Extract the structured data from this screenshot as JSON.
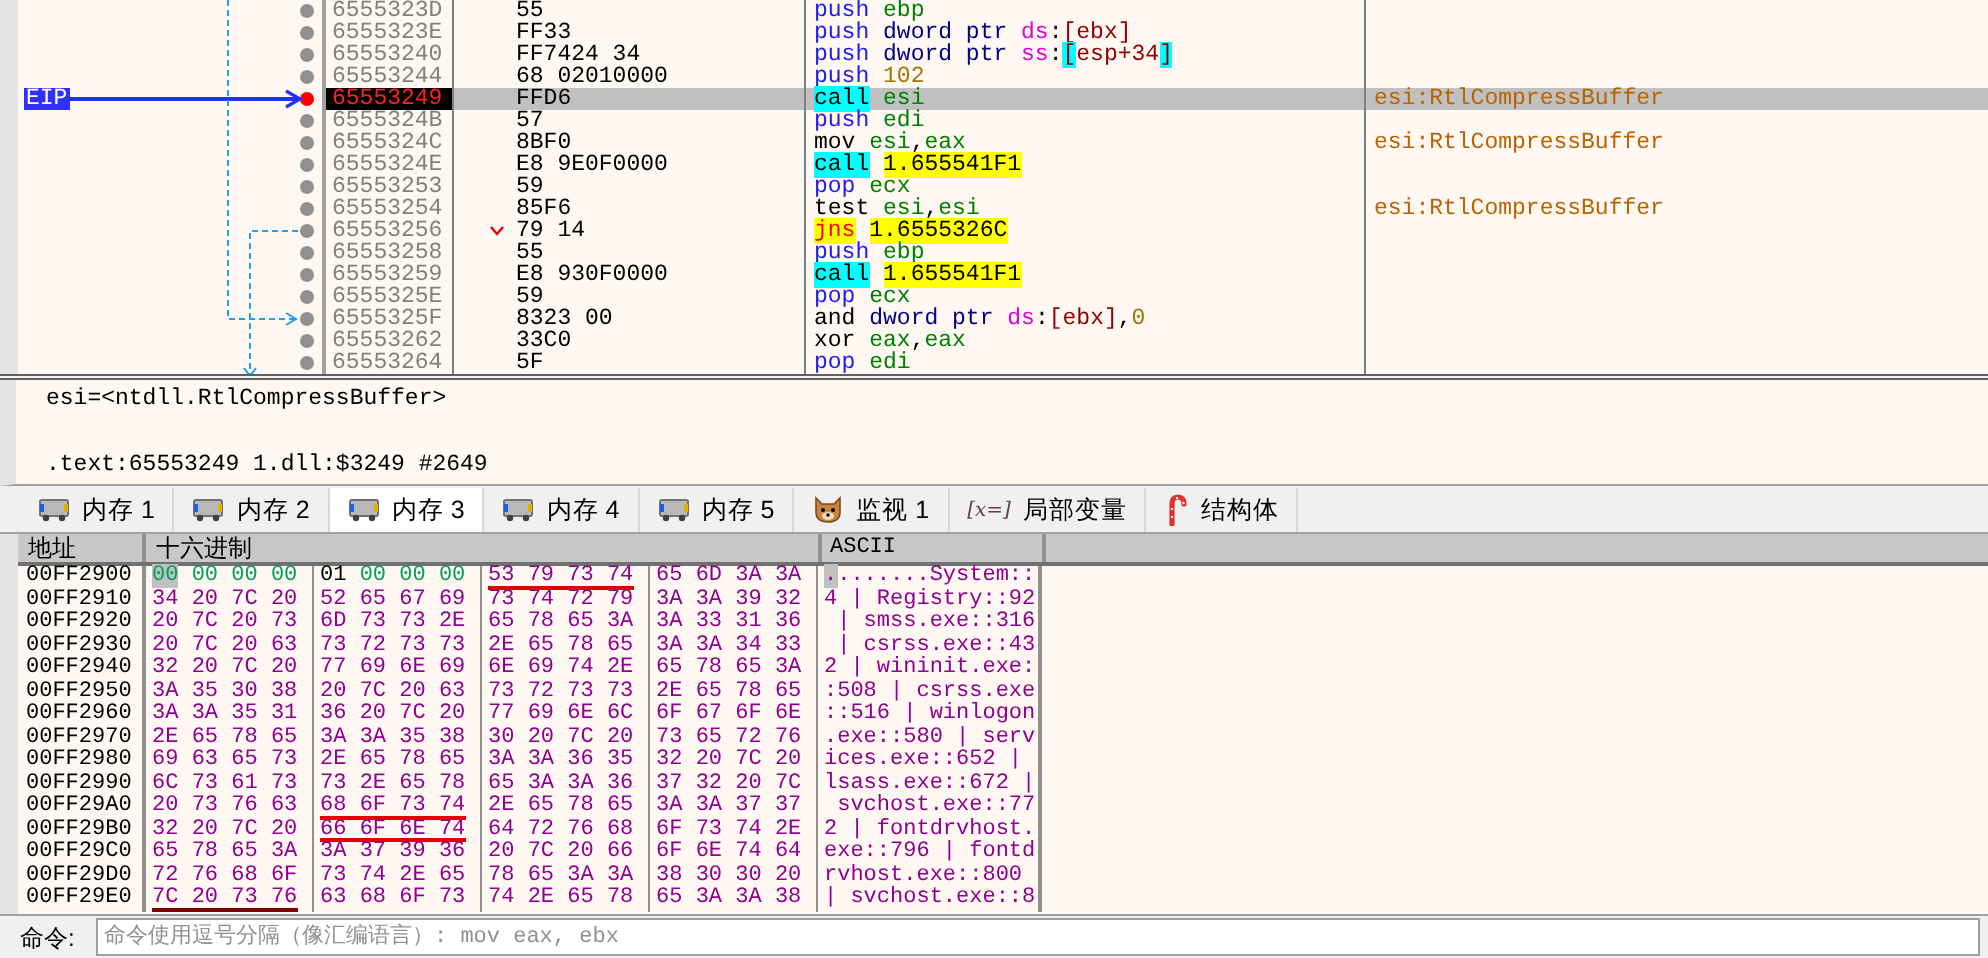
{
  "disassembly": {
    "eip_label": "EIP",
    "rows": [
      {
        "address": "6555323D",
        "bytes": "55",
        "current": false,
        "branch": false,
        "instruction": [
          {
            "text": "push",
            "kind": "stack"
          },
          {
            "text": " ebp",
            "kind": "reg"
          }
        ]
      },
      {
        "address": "6555323E",
        "bytes": "FF33",
        "current": false,
        "branch": false,
        "instruction": [
          {
            "text": "push",
            "kind": "stack"
          },
          {
            "text": " dword ptr ",
            "kind": "size"
          },
          {
            "text": "ds",
            "kind": "seg"
          },
          {
            "text": ":",
            "kind": "plain"
          },
          {
            "text": "[ebx]",
            "kind": "mem"
          }
        ]
      },
      {
        "address": "65553240",
        "bytes": "FF7424 34",
        "current": false,
        "branch": false,
        "instruction": [
          {
            "text": "push",
            "kind": "stack"
          },
          {
            "text": " dword ptr ",
            "kind": "size"
          },
          {
            "text": "ss",
            "kind": "seg"
          },
          {
            "text": ":",
            "kind": "plain"
          },
          {
            "text": "[",
            "kind": "hl"
          },
          {
            "text": "esp+34",
            "kind": "mem"
          },
          {
            "text": "]",
            "kind": "hl"
          }
        ]
      },
      {
        "address": "65553244",
        "bytes": "68 02010000",
        "current": false,
        "branch": false,
        "instruction": [
          {
            "text": "push",
            "kind": "stack"
          },
          {
            "text": " 102",
            "kind": "num"
          }
        ]
      },
      {
        "address": "65553249",
        "bytes": "FFD6",
        "current": true,
        "branch": false,
        "instruction": [
          {
            "text": "call",
            "kind": "call"
          },
          {
            "text": " esi",
            "kind": "reg"
          }
        ],
        "comment": "esi:RtlCompressBuffer"
      },
      {
        "address": "6555324B",
        "bytes": "57",
        "current": false,
        "branch": false,
        "instruction": [
          {
            "text": "push",
            "kind": "stack"
          },
          {
            "text": " edi",
            "kind": "reg"
          }
        ]
      },
      {
        "address": "6555324C",
        "bytes": "8BF0",
        "current": false,
        "branch": false,
        "instruction": [
          {
            "text": "mov",
            "kind": "plain"
          },
          {
            "text": " esi",
            "kind": "reg"
          },
          {
            "text": ",",
            "kind": "plain"
          },
          {
            "text": "eax",
            "kind": "reg"
          }
        ],
        "comment": "esi:RtlCompressBuffer"
      },
      {
        "address": "6555324E",
        "bytes": "E8 9E0F0000",
        "current": false,
        "branch": false,
        "instruction": [
          {
            "text": "call",
            "kind": "call"
          },
          {
            "text": " 1.655541F1",
            "kind": "addr"
          }
        ]
      },
      {
        "address": "65553253",
        "bytes": "59",
        "current": false,
        "branch": false,
        "instruction": [
          {
            "text": "pop",
            "kind": "stack"
          },
          {
            "text": " ecx",
            "kind": "reg"
          }
        ]
      },
      {
        "address": "65553254",
        "bytes": "85F6",
        "current": false,
        "branch": false,
        "instruction": [
          {
            "text": "test",
            "kind": "plain"
          },
          {
            "text": " esi",
            "kind": "reg"
          },
          {
            "text": ",",
            "kind": "plain"
          },
          {
            "text": "esi",
            "kind": "reg"
          }
        ],
        "comment": "esi:RtlCompressBuffer"
      },
      {
        "address": "65553256",
        "bytes": "79 14",
        "current": false,
        "branch": true,
        "instruction": [
          {
            "text": "jns",
            "kind": "jump"
          },
          {
            "text": " 1.6555326C",
            "kind": "addr"
          }
        ]
      },
      {
        "address": "65553258",
        "bytes": "55",
        "current": false,
        "branch": false,
        "instruction": [
          {
            "text": "push",
            "kind": "stack"
          },
          {
            "text": " ebp",
            "kind": "reg"
          }
        ]
      },
      {
        "address": "65553259",
        "bytes": "E8 930F0000",
        "current": false,
        "branch": false,
        "instruction": [
          {
            "text": "call",
            "kind": "call"
          },
          {
            "text": " 1.655541F1",
            "kind": "addr"
          }
        ]
      },
      {
        "address": "6555325E",
        "bytes": "59",
        "current": false,
        "branch": false,
        "instruction": [
          {
            "text": "pop",
            "kind": "stack"
          },
          {
            "text": " ecx",
            "kind": "reg"
          }
        ]
      },
      {
        "address": "6555325F",
        "bytes": "8323 00",
        "current": false,
        "branch": false,
        "instruction": [
          {
            "text": "and",
            "kind": "plain"
          },
          {
            "text": " dword ptr ",
            "kind": "size"
          },
          {
            "text": "ds",
            "kind": "seg"
          },
          {
            "text": ":",
            "kind": "plain"
          },
          {
            "text": "[ebx]",
            "kind": "mem"
          },
          {
            "text": ",",
            "kind": "plain"
          },
          {
            "text": "0",
            "kind": "num"
          }
        ]
      },
      {
        "address": "65553262",
        "bytes": "33C0",
        "current": false,
        "branch": false,
        "instruction": [
          {
            "text": "xor",
            "kind": "plain"
          },
          {
            "text": " eax",
            "kind": "reg"
          },
          {
            "text": ",",
            "kind": "plain"
          },
          {
            "text": "eax",
            "kind": "reg"
          }
        ]
      },
      {
        "address": "65553264",
        "bytes": "5F",
        "current": false,
        "branch": false,
        "instruction": [
          {
            "text": "pop",
            "kind": "stack"
          },
          {
            "text": " edi",
            "kind": "reg"
          }
        ]
      }
    ]
  },
  "info": [
    "esi=<ntdll.RtlCompressBuffer>",
    ".text:65553249 1.dll:$3249 #2649"
  ],
  "tabs": [
    {
      "label": "内存 1",
      "kind": "memory",
      "selected": false
    },
    {
      "label": "内存 2",
      "kind": "memory",
      "selected": false
    },
    {
      "label": "内存 3",
      "kind": "memory",
      "selected": true
    },
    {
      "label": "内存 4",
      "kind": "memory",
      "selected": false
    },
    {
      "label": "内存 5",
      "kind": "memory",
      "selected": false
    },
    {
      "label": "监视 1",
      "kind": "watch",
      "selected": false
    },
    {
      "label": "局部变量",
      "kind": "locals",
      "icon_text": "[x=]",
      "selected": false
    },
    {
      "label": "结构体",
      "kind": "struct",
      "selected": false
    }
  ],
  "dump": {
    "columns": [
      "地址",
      "十六进制",
      "ASCII"
    ],
    "rows": [
      {
        "address": "00FF2900",
        "selected": true,
        "groups": [
          {
            "bytes": "00 00 00 00",
            "underlined": false
          },
          {
            "bytes": "01 00 00 00",
            "underlined": false
          },
          {
            "bytes": "53 79 73 74",
            "underlined": true,
            "color": "#e00000"
          },
          {
            "bytes": "65 6D 3A 3A",
            "underlined": false
          }
        ],
        "ascii": "........System::"
      },
      {
        "address": "00FF2910",
        "selected": false,
        "groups": [
          {
            "bytes": "34 20 7C 20",
            "underlined": false
          },
          {
            "bytes": "52 65 67 69",
            "underlined": false
          },
          {
            "bytes": "73 74 72 79",
            "underlined": false
          },
          {
            "bytes": "3A 3A 39 32",
            "underlined": false
          }
        ],
        "ascii": "4 | Registry::92"
      },
      {
        "address": "00FF2920",
        "selected": false,
        "groups": [
          {
            "bytes": "20 7C 20 73",
            "underlined": false
          },
          {
            "bytes": "6D 73 73 2E",
            "underlined": false
          },
          {
            "bytes": "65 78 65 3A",
            "underlined": false
          },
          {
            "bytes": "3A 33 31 36",
            "underlined": false
          }
        ],
        "ascii": " | smss.exe::316"
      },
      {
        "address": "00FF2930",
        "selected": false,
        "groups": [
          {
            "bytes": "20 7C 20 63",
            "underlined": false
          },
          {
            "bytes": "73 72 73 73",
            "underlined": false
          },
          {
            "bytes": "2E 65 78 65",
            "underlined": false
          },
          {
            "bytes": "3A 3A 34 33",
            "underlined": false
          }
        ],
        "ascii": " | csrss.exe::43"
      },
      {
        "address": "00FF2940",
        "selected": false,
        "groups": [
          {
            "bytes": "32 20 7C 20",
            "underlined": false
          },
          {
            "bytes": "77 69 6E 69",
            "underlined": false
          },
          {
            "bytes": "6E 69 74 2E",
            "underlined": false
          },
          {
            "bytes": "65 78 65 3A",
            "underlined": false
          }
        ],
        "ascii": "2 | wininit.exe:"
      },
      {
        "address": "00FF2950",
        "selected": false,
        "groups": [
          {
            "bytes": "3A 35 30 38",
            "underlined": false
          },
          {
            "bytes": "20 7C 20 63",
            "underlined": false
          },
          {
            "bytes": "73 72 73 73",
            "underlined": false
          },
          {
            "bytes": "2E 65 78 65",
            "underlined": false
          }
        ],
        "ascii": ":508 | csrss.exe"
      },
      {
        "address": "00FF2960",
        "selected": false,
        "groups": [
          {
            "bytes": "3A 3A 35 31",
            "underlined": false
          },
          {
            "bytes": "36 20 7C 20",
            "underlined": false
          },
          {
            "bytes": "77 69 6E 6C",
            "underlined": false
          },
          {
            "bytes": "6F 67 6F 6E",
            "underlined": false
          }
        ],
        "ascii": "::516 | winlogon"
      },
      {
        "address": "00FF2970",
        "selected": false,
        "groups": [
          {
            "bytes": "2E 65 78 65",
            "underlined": false
          },
          {
            "bytes": "3A 3A 35 38",
            "underlined": false
          },
          {
            "bytes": "30 20 7C 20",
            "underlined": false
          },
          {
            "bytes": "73 65 72 76",
            "underlined": false
          }
        ],
        "ascii": ".exe::580 | serv"
      },
      {
        "address": "00FF2980",
        "selected": false,
        "groups": [
          {
            "bytes": "69 63 65 73",
            "underlined": false
          },
          {
            "bytes": "2E 65 78 65",
            "underlined": false
          },
          {
            "bytes": "3A 3A 36 35",
            "underlined": false
          },
          {
            "bytes": "32 20 7C 20",
            "underlined": false
          }
        ],
        "ascii": "ices.exe::652 | "
      },
      {
        "address": "00FF2990",
        "selected": false,
        "groups": [
          {
            "bytes": "6C 73 61 73",
            "underlined": false
          },
          {
            "bytes": "73 2E 65 78",
            "underlined": false
          },
          {
            "bytes": "65 3A 3A 36",
            "underlined": false
          },
          {
            "bytes": "37 32 20 7C",
            "underlined": false
          }
        ],
        "ascii": "lsass.exe::672 |"
      },
      {
        "address": "00FF29A0",
        "selected": false,
        "groups": [
          {
            "bytes": "20 73 76 63",
            "underlined": false
          },
          {
            "bytes": "68 6F 73 74",
            "underlined": true,
            "color": "#e00000"
          },
          {
            "bytes": "2E 65 78 65",
            "underlined": false
          },
          {
            "bytes": "3A 3A 37 37",
            "underlined": false
          }
        ],
        "ascii": " svchost.exe::77"
      },
      {
        "address": "00FF29B0",
        "selected": false,
        "groups": [
          {
            "bytes": "32 20 7C 20",
            "underlined": false
          },
          {
            "bytes": "66 6F 6E 74",
            "underlined": true,
            "color": "#e00000"
          },
          {
            "bytes": "64 72 76 68",
            "underlined": false
          },
          {
            "bytes": "6F 73 74 2E",
            "underlined": false
          }
        ],
        "ascii": "2 | fontdrvhost."
      },
      {
        "address": "00FF29C0",
        "selected": false,
        "groups": [
          {
            "bytes": "65 78 65 3A",
            "underlined": false
          },
          {
            "bytes": "3A 37 39 36",
            "underlined": false
          },
          {
            "bytes": "20 7C 20 66",
            "underlined": false
          },
          {
            "bytes": "6F 6E 74 64",
            "underlined": false
          }
        ],
        "ascii": "exe::796 | fontd"
      },
      {
        "address": "00FF29D0",
        "selected": false,
        "groups": [
          {
            "bytes": "72 76 68 6F",
            "underlined": false
          },
          {
            "bytes": "73 74 2E 65",
            "underlined": false
          },
          {
            "bytes": "78 65 3A 3A",
            "underlined": false
          },
          {
            "bytes": "38 30 30 20",
            "underlined": false
          }
        ],
        "ascii": "rvhost.exe::800 "
      },
      {
        "address": "00FF29E0",
        "selected": false,
        "groups": [
          {
            "bytes": "7C 20 73 76",
            "underlined": true,
            "color": "#800000"
          },
          {
            "bytes": "63 68 6F 73",
            "underlined": false
          },
          {
            "bytes": "74 2E 65 78",
            "underlined": false
          },
          {
            "bytes": "65 3A 3A 38",
            "underlined": false
          }
        ],
        "ascii": "| svchost.exe::8"
      }
    ]
  },
  "command": {
    "label": "命令:",
    "placeholder": "命令使用逗号分隔（像汇编语言）: mov eax, ebx"
  }
}
